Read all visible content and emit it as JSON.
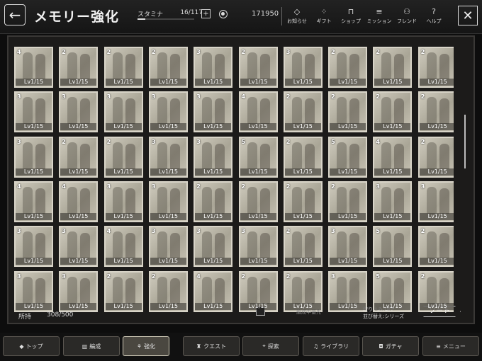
{
  "header": {
    "title": "メモリー強化",
    "stamina_label": "スタミナ",
    "stamina_value": "16/117",
    "stamina_fraction": 0.137,
    "coins": "171950",
    "menus": [
      {
        "label": "お知らせ",
        "icon": "diamond-icon"
      },
      {
        "label": "ギフト",
        "icon": "gift-icon"
      },
      {
        "label": "ショップ",
        "icon": "shop-icon"
      },
      {
        "label": "ミッション",
        "icon": "mission-icon"
      },
      {
        "label": "フレンド",
        "icon": "friend-icon"
      },
      {
        "label": "ヘルプ",
        "icon": "help-icon"
      }
    ]
  },
  "cards": {
    "level_text": "Lv1/15",
    "ranks": [
      [
        "4",
        "2",
        "2",
        "2",
        "3",
        "2",
        "3",
        "2",
        "2",
        "2"
      ],
      [
        "3",
        "3",
        "3",
        "3",
        "3",
        "4",
        "2",
        "2",
        "2",
        "2"
      ],
      [
        "3",
        "2",
        "2",
        "3",
        "3",
        "5",
        "2",
        "5",
        "4",
        "2"
      ],
      [
        "4",
        "4",
        "3",
        "3",
        "2",
        "2",
        "2",
        "2",
        "3",
        "3"
      ],
      [
        "3",
        "3",
        "4",
        "3",
        "3",
        "3",
        "2",
        "3",
        "5",
        "2"
      ],
      [
        "3",
        "3",
        "2",
        "2",
        "4",
        "2",
        "2",
        "3",
        "5",
        "2"
      ]
    ]
  },
  "footer": {
    "held_label": "所持",
    "held_count": "308/500",
    "priority_label": "編成中優先",
    "filter_text": "絞り込み:OFF",
    "sort_order_text": "並び替え:シリーズ",
    "sort_button": "ソート"
  },
  "nav": [
    {
      "label": "トップ",
      "icon": "top-icon",
      "active": false
    },
    {
      "label": "編成",
      "icon": "formation-icon",
      "active": false
    },
    {
      "label": "強化",
      "icon": "enhance-icon",
      "active": true
    },
    {
      "label": "クエスト",
      "icon": "quest-icon",
      "active": false
    },
    {
      "label": "探索",
      "icon": "explore-icon",
      "active": false
    },
    {
      "label": "ライブラリ",
      "icon": "library-icon",
      "active": false
    },
    {
      "label": "ガチャ",
      "icon": "gacha-icon",
      "active": false
    },
    {
      "label": "メニュー",
      "icon": "menu-icon",
      "active": false
    }
  ]
}
